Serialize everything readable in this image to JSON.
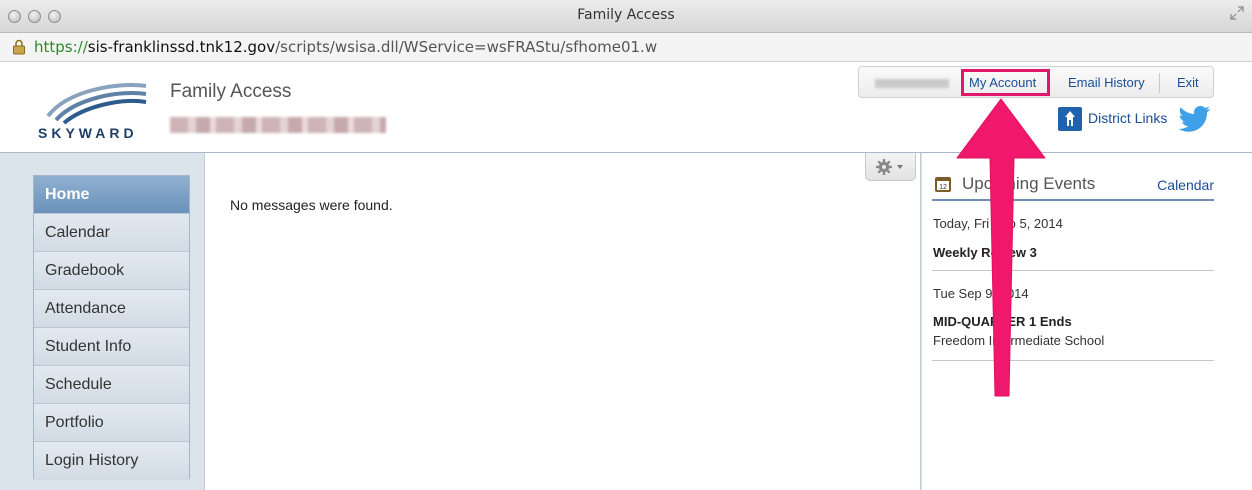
{
  "window": {
    "title": "Family Access"
  },
  "url": {
    "scheme": "https://",
    "host": "sis-franklinssd.tnk12.gov",
    "path": "/scripts/wsisa.dll/WService=wsFRAStu/sfhome01.w"
  },
  "header": {
    "app_title": "Family Access",
    "logo_text": "SKYWARD",
    "top_links": {
      "my_account": "My Account",
      "email_history": "Email History",
      "exit": "Exit"
    },
    "district_links": "District Links"
  },
  "sidebar": {
    "items": [
      {
        "label": "Home",
        "active": true
      },
      {
        "label": "Calendar"
      },
      {
        "label": "Gradebook"
      },
      {
        "label": "Attendance"
      },
      {
        "label": "Student Info"
      },
      {
        "label": "Schedule"
      },
      {
        "label": "Portfolio"
      },
      {
        "label": "Login History"
      }
    ]
  },
  "main": {
    "message": "No messages were found."
  },
  "events": {
    "title": "Upcoming Events",
    "calendar_link": "Calendar",
    "items": [
      {
        "date": "Today, Fri Sep 5, 2014",
        "name": "Weekly Review 3",
        "location": ""
      },
      {
        "date": "Tue Sep 9, 2014",
        "name": "MID-QUARTER 1 Ends",
        "location": "Freedom Intermediate School"
      }
    ]
  },
  "colors": {
    "link": "#1a4d96",
    "highlight": "#e0186a",
    "active_nav": "#6b92ba"
  },
  "icons": [
    "lock-icon",
    "resize-icon",
    "gear-icon",
    "calendar-icon",
    "district-icon",
    "twitter-icon",
    "arrow-annotation"
  ]
}
